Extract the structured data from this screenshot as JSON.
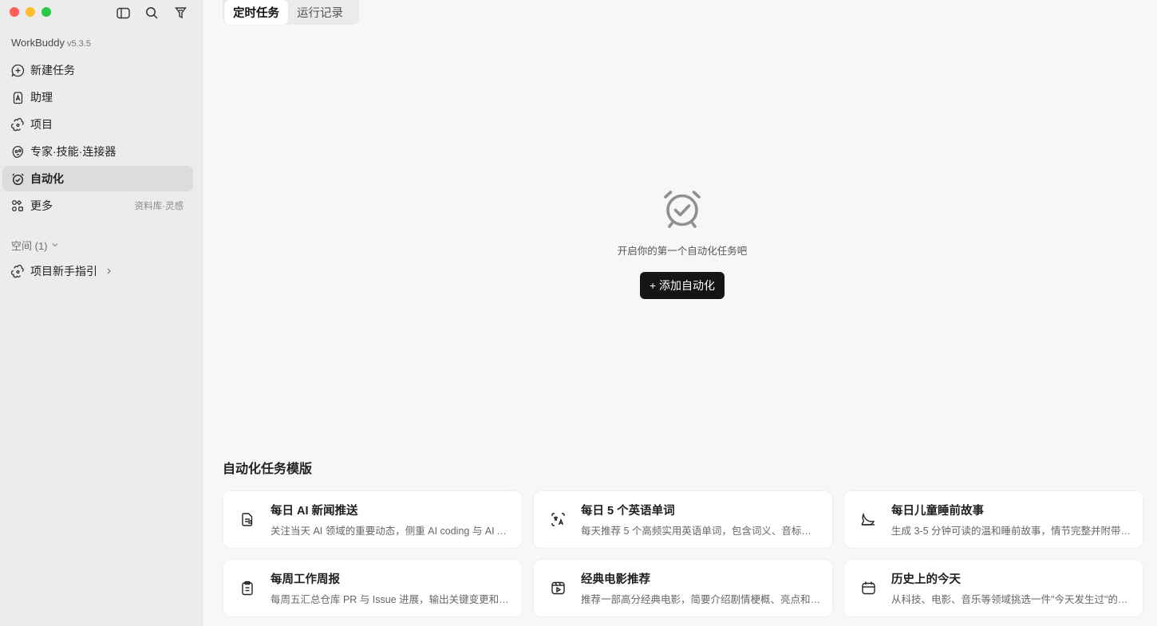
{
  "app": {
    "name": "WorkBuddy",
    "version": "v5.3.5"
  },
  "window_controls": [
    "close",
    "minimize",
    "zoom"
  ],
  "top_icons": [
    "sidebar-toggle-icon",
    "search-icon",
    "filter-icon"
  ],
  "sidebar": {
    "items": [
      {
        "label": "新建任务",
        "icon": "plus-chat-icon"
      },
      {
        "label": "助理",
        "icon": "assistant-icon"
      },
      {
        "label": "项目",
        "icon": "project-icon"
      },
      {
        "label": "专家·技能·连接器",
        "icon": "expert-icon"
      },
      {
        "label": "自动化",
        "icon": "alarm-clock-icon",
        "active": true
      },
      {
        "label": "更多",
        "icon": "grid-icon",
        "hint": "资料库·灵感"
      }
    ],
    "space": {
      "label": "空间 (1)",
      "items": [
        {
          "label": "项目新手指引"
        }
      ]
    }
  },
  "tabs": [
    {
      "label": "定时任务",
      "active": true
    },
    {
      "label": "运行记录"
    }
  ],
  "empty_state": {
    "text": "开启你的第一个自动化任务吧",
    "button": "+ 添加自动化"
  },
  "templates": {
    "title": "自动化任务模版",
    "cards": [
      {
        "title": "每日 AI 新闻推送",
        "desc": "关注当天 AI 领域的重要动态，侧重 AI coding 与 AI Agent 方向",
        "icon": "news-icon"
      },
      {
        "title": "每日 5 个英语单词",
        "desc": "每天推荐 5 个高频实用英语单词，包含词义、音标和例句",
        "icon": "translate-icon"
      },
      {
        "title": "每日儿童睡前故事",
        "desc": "生成 3-5 分钟可读的温和睡前故事，情节完整并附带寓意",
        "icon": "moon-icon"
      },
      {
        "title": "每周工作周报",
        "desc": "每周五汇总仓库 PR 与 Issue 进展，输出关键变更和待办",
        "icon": "clipboard-icon"
      },
      {
        "title": "经典电影推荐",
        "desc": "推荐一部高分经典电影，简要介绍剧情梗概、亮点和观影理由",
        "icon": "film-icon"
      },
      {
        "title": "历史上的今天",
        "desc": "从科技、电影、音乐等领域挑选一件\"今天发生过\"的事件",
        "icon": "calendar-icon"
      }
    ]
  }
}
